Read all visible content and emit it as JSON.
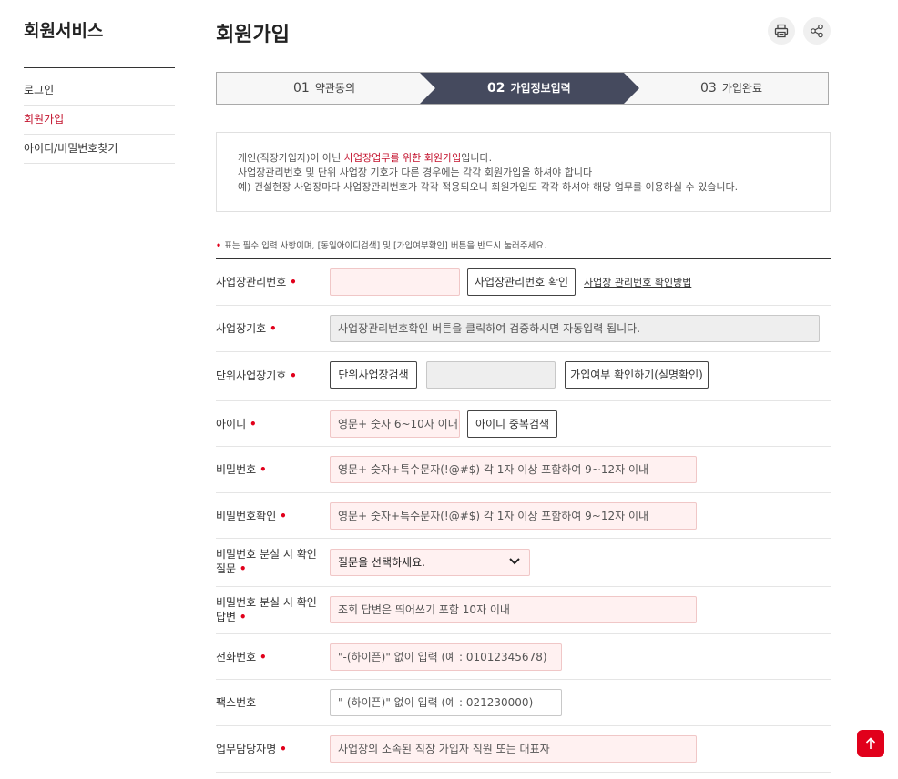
{
  "sidebar": {
    "title": "회원서비스",
    "items": [
      {
        "label": "로그인",
        "active": false
      },
      {
        "label": "회원가입",
        "active": true
      },
      {
        "label": "아이디/비밀번호찾기",
        "active": false
      }
    ]
  },
  "header": {
    "title": "회원가입",
    "print_icon": "print-icon",
    "share_icon": "share-icon"
  },
  "steps": [
    {
      "num": "01",
      "label": "약관동의"
    },
    {
      "num": "02",
      "label": "가입정보입력"
    },
    {
      "num": "03",
      "label": "가입완료"
    }
  ],
  "notice": {
    "line1_prefix": "개인(직장가입자)이 아닌 ",
    "line1_red": "사업장업무를 위한 회원가입",
    "line1_suffix": "입니다.",
    "line2": "사업장관리번호 및 단위 사업장 기호가 다른 경우에는 각각 회원가입을 하셔야 합니다",
    "line3": "예) 건설현장 사업장마다 사업장관리번호가 각각 적용되오니 회원가입도 각각 하셔야 해당 업무를 이용하실 수 있습니다."
  },
  "required_note": {
    "dot": "•",
    "text": " 표는 필수 입력 사항이며, [동일아이디검색] 및 [가입여부확인] 버튼을 반드시 눌러주세요."
  },
  "form": {
    "required_mark": "•",
    "biz_no": {
      "label": "사업장관리번호",
      "value": "",
      "check_button": "사업장관리번호 확인",
      "help_link": "사업장 관리번호 확인방법"
    },
    "biz_code": {
      "label": "사업장기호",
      "placeholder": "사업장관리번호확인 버튼을 클릭하여 검증하시면 자동입력 됩니다."
    },
    "unit_biz_code": {
      "label": "단위사업장기호",
      "search_button": "단위사업장검색",
      "value": "",
      "check_button": "가입여부 확인하기(실명확인)"
    },
    "user_id": {
      "label": "아이디",
      "placeholder": "영문+ 숫자 6~10자 이내",
      "check_button": "아이디 중복검색"
    },
    "password": {
      "label": "비밀번호",
      "placeholder": "영문+ 숫자+특수문자(!@#$) 각 1자 이상 포함하여 9~12자 이내"
    },
    "password_confirm": {
      "label": "비밀번호확인",
      "placeholder": "영문+ 숫자+특수문자(!@#$) 각 1자 이상 포함하여 9~12자 이내"
    },
    "question": {
      "label": "비밀번호 분실 시 확인 질문",
      "selected": "질문을 선택하세요."
    },
    "answer": {
      "label": "비밀번호 분실 시 확인 답변",
      "placeholder": "조회 답변은 띄어쓰기 포함 10자 이내"
    },
    "phone": {
      "label": "전화번호",
      "placeholder": "\"-(하이픈)\" 없이 입력 (예 : 01012345678)"
    },
    "fax": {
      "label": "팩스번호",
      "placeholder": "\"-(하이픈)\" 없이 입력 (예 : 021230000)"
    },
    "manager": {
      "label": "업무담당자명",
      "placeholder": "사업장의 소속된 직장 가입자 직원 또는 대표자"
    }
  },
  "top_button_icon": "arrow-up-icon",
  "colors": {
    "accent": "#c3122d",
    "required": "#e1001b",
    "step_active": "#454a5e",
    "input_required_bg": "#fff1f1"
  }
}
